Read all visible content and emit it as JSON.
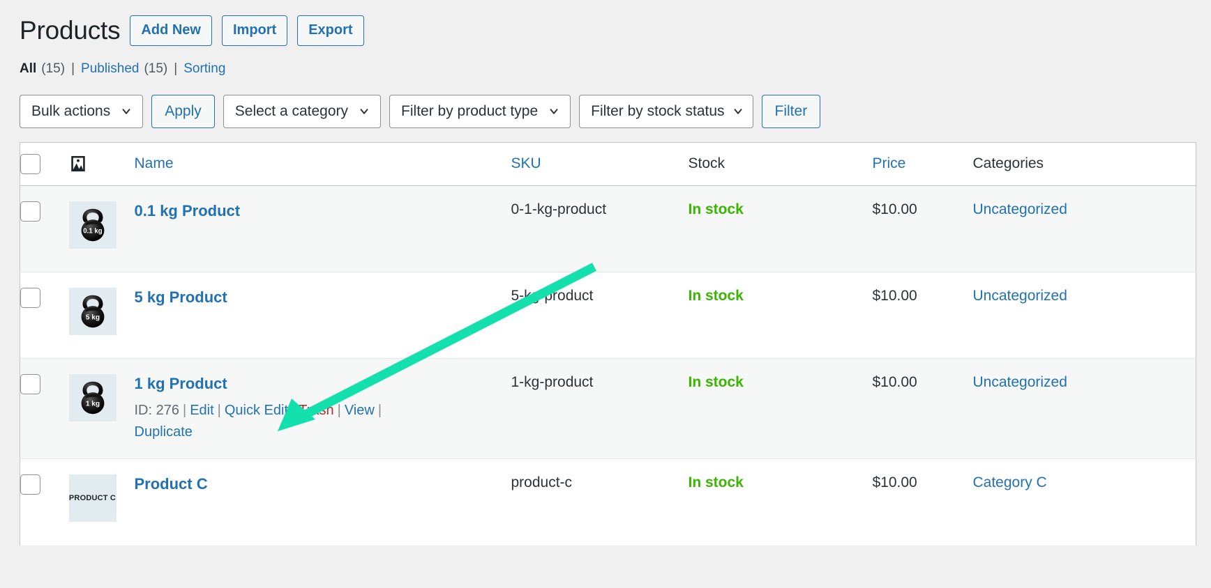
{
  "header": {
    "title": "Products",
    "actions": [
      {
        "label": "Add New",
        "name": "add-new-button"
      },
      {
        "label": "Import",
        "name": "import-button"
      },
      {
        "label": "Export",
        "name": "export-button"
      }
    ]
  },
  "status_links": {
    "all_label": "All",
    "all_count": "(15)",
    "published_label": "Published",
    "published_count": "(15)",
    "sorting_label": "Sorting",
    "separator": "|"
  },
  "tablenav": {
    "bulk_actions": "Bulk actions",
    "apply_label": "Apply",
    "category_filter": "Select a category",
    "product_type_filter": "Filter by product type",
    "stock_status_filter": "Filter by stock status",
    "filter_label": "Filter"
  },
  "table": {
    "columns": {
      "thumb": "image-icon",
      "name": "Name",
      "sku": "SKU",
      "stock": "Stock",
      "price": "Price",
      "categories": "Categories"
    },
    "rows": [
      {
        "name": "0.1 kg Product",
        "thumb_type": "kettlebell",
        "thumb_label": "0.1 kg",
        "sku": "0-1-kg-product",
        "stock": "In stock",
        "price": "$10.00",
        "category": "Uncategorized",
        "actions": null
      },
      {
        "name": "5 kg Product",
        "thumb_type": "kettlebell",
        "thumb_label": "5 kg",
        "sku": "5-kg-product",
        "stock": "In stock",
        "price": "$10.00",
        "category": "Uncategorized",
        "actions": null
      },
      {
        "name": "1 kg Product",
        "thumb_type": "kettlebell",
        "thumb_label": "1 kg",
        "sku": "1-kg-product",
        "stock": "In stock",
        "price": "$10.00",
        "category": "Uncategorized",
        "actions": {
          "id_label": "ID: 276",
          "edit": "Edit",
          "quick_edit": "Quick Edit",
          "trash": "Trash",
          "view": "View",
          "duplicate": "Duplicate"
        }
      },
      {
        "name": "Product C",
        "thumb_type": "text",
        "thumb_label": "PRODUCT C",
        "sku": "product-c",
        "stock": "In stock",
        "price": "$10.00",
        "category": "Category C",
        "actions": null
      }
    ]
  },
  "annotation": {
    "arrow_color": "#14e0ad",
    "points_to": "1 kg Product"
  },
  "colors": {
    "link": "#2271b1",
    "trash": "#b32d2e",
    "in_stock": "#3ab500",
    "page_bg": "#f0f0f1",
    "row_alt_bg": "#f6f7f7",
    "thumb_bg": "#e2ebef"
  }
}
